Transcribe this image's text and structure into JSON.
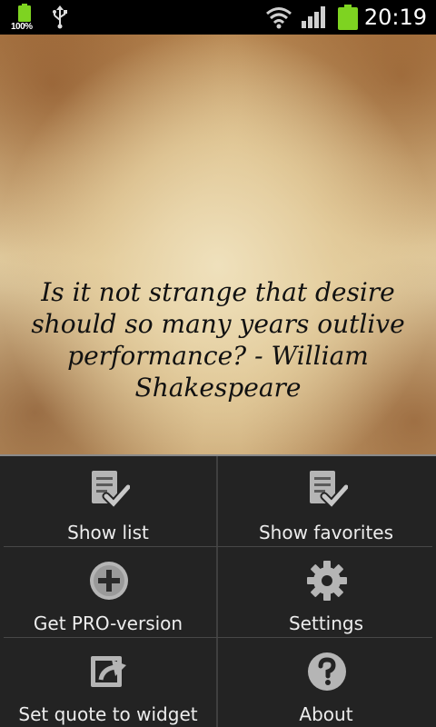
{
  "status_bar": {
    "battery_percent": "100%",
    "time": "20:19",
    "icons": [
      "battery-small-icon",
      "usb-icon",
      "wifi-icon",
      "signal-icon",
      "battery-icon"
    ],
    "battery_color": "#7ed321"
  },
  "quote": {
    "text": "Is it not strange that desire should so many years outlive performance? - William Shakespeare"
  },
  "menu": {
    "items": [
      {
        "label": "Show list",
        "icon": "list-check-icon"
      },
      {
        "label": "Show favorites",
        "icon": "list-check-icon"
      },
      {
        "label": "Get PRO-version",
        "icon": "plus-circle-icon"
      },
      {
        "label": "Settings",
        "icon": "gear-icon"
      },
      {
        "label": "Set quote to widget",
        "icon": "widget-export-icon"
      },
      {
        "label": "About",
        "icon": "help-icon"
      }
    ]
  },
  "colors": {
    "menu_background": "#232323",
    "menu_text": "#ededed",
    "icon_gray": "#b5b5b5",
    "quote_text": "#111111"
  }
}
